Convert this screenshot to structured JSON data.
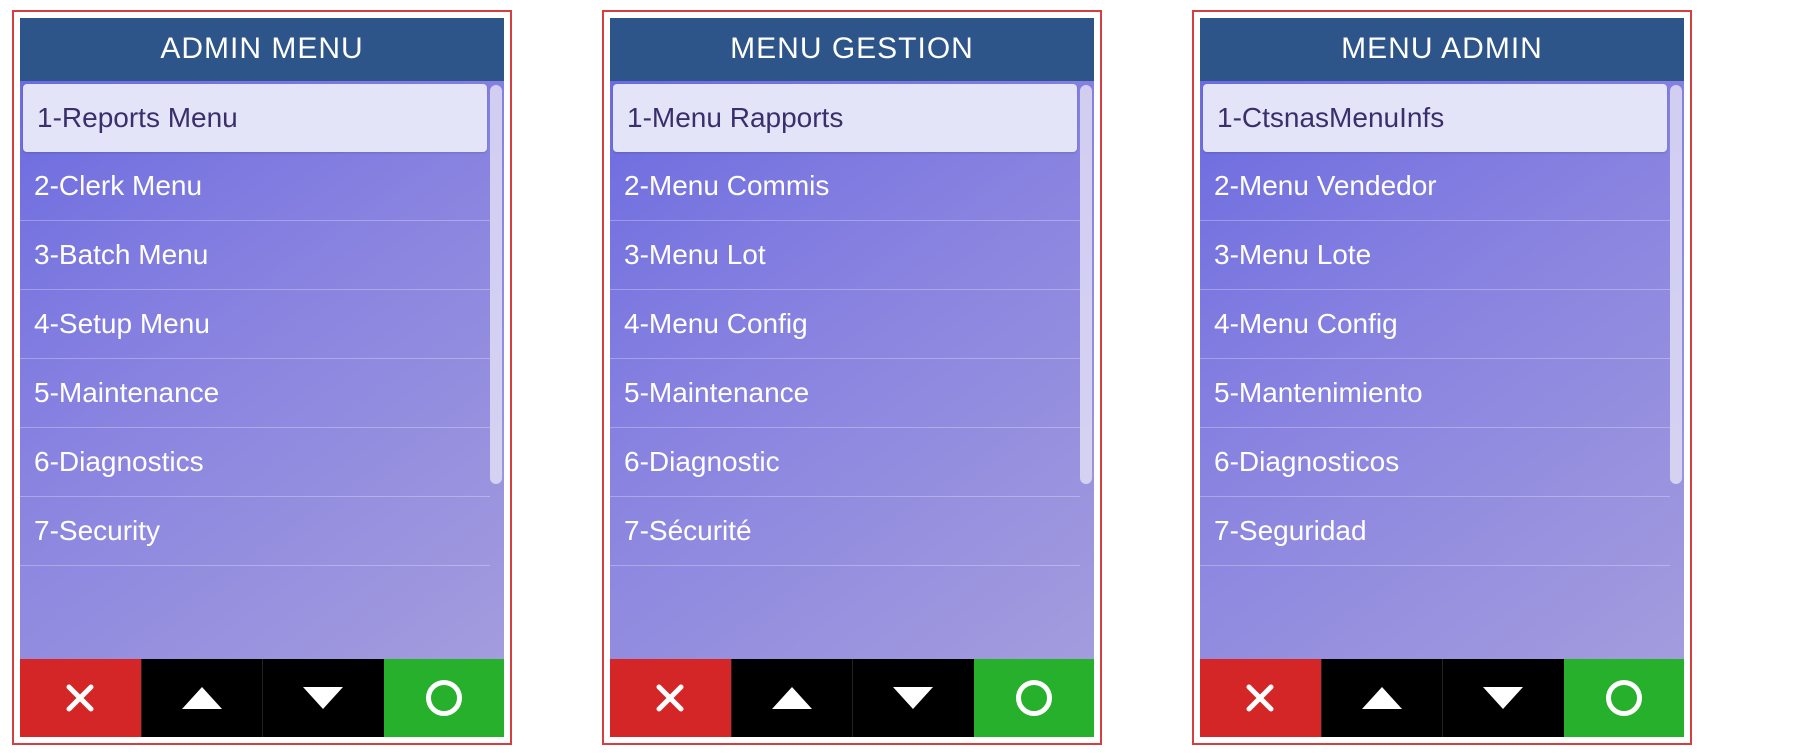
{
  "screens": [
    {
      "title": "ADMIN MENU",
      "items": [
        "1-Reports Menu",
        "2-Clerk Menu",
        "3-Batch Menu",
        "4-Setup Menu",
        "5-Maintenance",
        "6-Diagnostics",
        "7-Security"
      ],
      "selected_index": 0,
      "scroll_thumb_height_percent": 70
    },
    {
      "title": "MENU GESTION",
      "items": [
        "1-Menu Rapports",
        "2-Menu Commis",
        "3-Menu Lot",
        "4-Menu Config",
        "5-Maintenance",
        "6-Diagnostic",
        "7-Sécurité"
      ],
      "selected_index": 0,
      "scroll_thumb_height_percent": 70
    },
    {
      "title": "MENU ADMIN",
      "items": [
        "1-CtsnasMenuInfs",
        "2-Menu Vendedor",
        "3-Menu Lote",
        "4-Menu Config",
        "5-Mantenimiento",
        "6-Diagnosticos",
        "7-Seguridad"
      ],
      "selected_index": 0,
      "scroll_thumb_height_percent": 70
    }
  ],
  "nav": {
    "cancel": "cancel",
    "up": "up",
    "down": "down",
    "ok": "ok"
  },
  "colors": {
    "header_bg": "#2d5589",
    "selected_bg": "#e4e4f8",
    "cancel_bg": "#d42626",
    "ok_bg": "#26b02b",
    "nav_bg": "#000000"
  }
}
